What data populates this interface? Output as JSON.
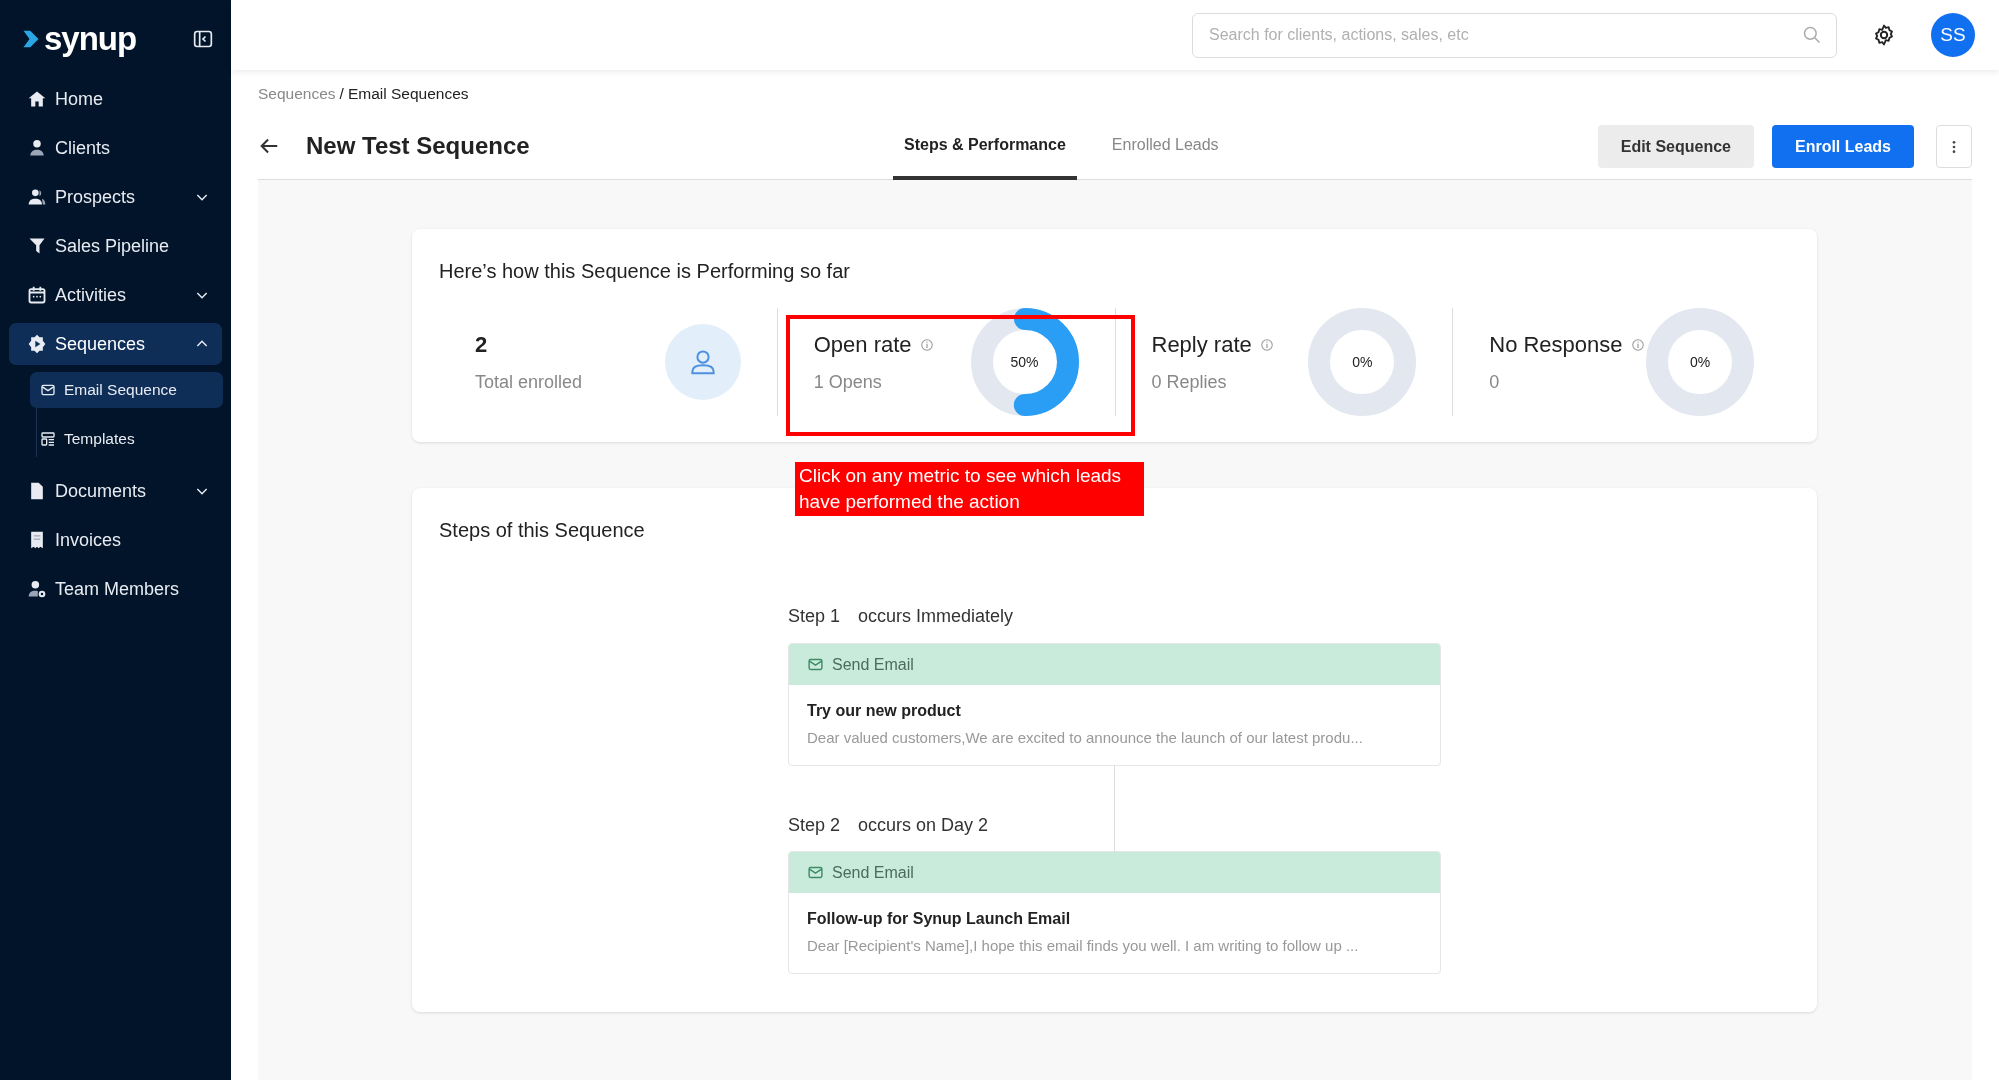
{
  "brand": {
    "name": "synup"
  },
  "sidebar": {
    "items": [
      {
        "label": "Home",
        "selected": false
      },
      {
        "label": "Clients",
        "selected": false
      },
      {
        "label": "Prospects",
        "selected": false,
        "expanded": false
      },
      {
        "label": "Sales Pipeline",
        "selected": false
      },
      {
        "label": "Activities",
        "selected": false,
        "expanded": false
      },
      {
        "label": "Sequences",
        "selected": true,
        "expanded": true,
        "children": [
          {
            "label": "Email Sequence",
            "selected": true
          },
          {
            "label": "Templates",
            "selected": false
          }
        ]
      },
      {
        "label": "Documents",
        "selected": false,
        "expanded": false
      },
      {
        "label": "Invoices",
        "selected": false
      },
      {
        "label": "Team Members",
        "selected": false
      }
    ]
  },
  "topbar": {
    "search": {
      "placeholder": "Search for clients, actions, sales, etc"
    },
    "avatar": "SS"
  },
  "breadcrumb": {
    "separator": "/",
    "items": [
      "Sequences",
      "Email Sequences"
    ]
  },
  "header": {
    "title": "New Test Sequence",
    "tabs": [
      {
        "label": "Steps & Performance",
        "selected": true
      },
      {
        "label": "Enrolled Leads",
        "selected": false
      }
    ],
    "buttons": [
      {
        "label": "Edit Sequence",
        "kind": "secondary"
      },
      {
        "label": "Enroll Leads",
        "kind": "primary"
      }
    ]
  },
  "performance": {
    "title": "Here’s how this Sequence is Performing so far",
    "metrics": [
      {
        "kind": "count",
        "value": "2",
        "label": "Total enrolled"
      },
      {
        "kind": "rate",
        "title": "Open rate",
        "detail": "1 Opens",
        "level": 0.5,
        "reading": "50%"
      },
      {
        "kind": "rate",
        "title": "Reply rate",
        "detail": "0 Replies",
        "reading": "0%"
      },
      {
        "kind": "rate",
        "title": "No Response",
        "detail": "0",
        "reading": "0%"
      }
    ]
  },
  "annotation": {
    "text": "Click on any metric to see which leads have performed the action"
  },
  "steps": {
    "title": "Steps of this Sequence",
    "items": [
      {
        "step": "Step 1",
        "timing": "occurs Immediately",
        "action": "Send Email",
        "subject": "Try our new product",
        "preview": "Dear valued customers,We are excited to announce the launch of our latest produ..."
      },
      {
        "step": "Step 2",
        "timing": "occurs on Day 2",
        "action": "Send Email",
        "subject": "Follow-up for Synup Launch Email",
        "preview": "Dear [Recipient's Name],I hope this email finds you well. I am writing to follow up ..."
      }
    ]
  }
}
